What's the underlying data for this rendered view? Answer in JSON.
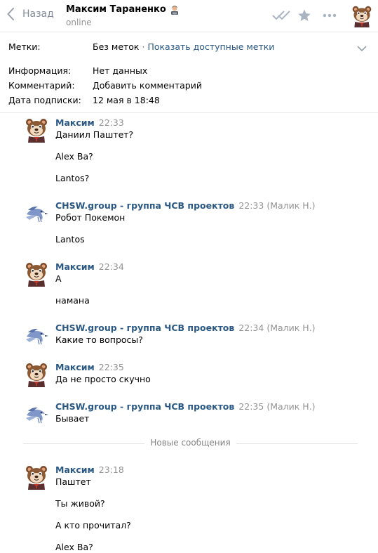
{
  "header": {
    "back_label": "Назад",
    "peer_name": "Максим Тараненко",
    "peer_status": "online"
  },
  "info": {
    "tags_label": "Метки:",
    "tags_value": "Без меток",
    "tags_separator": "·",
    "tags_link": "Показать доступные метки",
    "info_label": "Информация:",
    "info_value": "Нет данных",
    "comments_label": "Комментарий:",
    "comments_link": "Добавить комментарий",
    "subscribed_label": "Дата подписки:",
    "subscribed_value": "12 мая в 18:48"
  },
  "messages": [
    {
      "author": "Максим",
      "time": "22:33",
      "signature": "",
      "avatar": "user",
      "lines": [
        "Даниил Паштет?",
        "Alex Ba?",
        "Lantos?"
      ]
    },
    {
      "author": "CHSW.group - группа ЧСВ проектов",
      "time": "22:33",
      "signature": "(Малик Н.)",
      "avatar": "group",
      "lines": [
        "Робот Покемон",
        "Lantos"
      ]
    },
    {
      "author": "Максим",
      "time": "22:34",
      "signature": "",
      "avatar": "user",
      "lines": [
        "А",
        "намана"
      ]
    },
    {
      "author": "CHSW.group - группа ЧСВ проектов",
      "time": "22:34",
      "signature": "(Малик Н.)",
      "avatar": "group",
      "lines": [
        "Какие то вопросы?"
      ]
    },
    {
      "author": "Максим",
      "time": "22:35",
      "signature": "",
      "avatar": "user",
      "lines": [
        "Да не просто скучно"
      ]
    },
    {
      "author": "CHSW.group - группа ЧСВ проектов",
      "time": "22:35",
      "signature": "(Малик Н.)",
      "avatar": "group",
      "lines": [
        "Бывает"
      ]
    },
    {
      "author": "Максим",
      "time": "23:18",
      "signature": "",
      "avatar": "user",
      "lines": [
        "Паштет",
        "Ты живой?",
        "А кто прочитал?",
        "Alex Ba?"
      ]
    }
  ],
  "new_messages_label": "Новые сообщения",
  "colors": {
    "link": "#2a5885",
    "muted": "#939393",
    "divider": "#e7e8ec"
  },
  "icons": [
    "chevron-left-icon",
    "double-check-icon",
    "star-icon",
    "more-icon",
    "chevron-down-icon",
    "bear-avatar",
    "bird-logo"
  ]
}
